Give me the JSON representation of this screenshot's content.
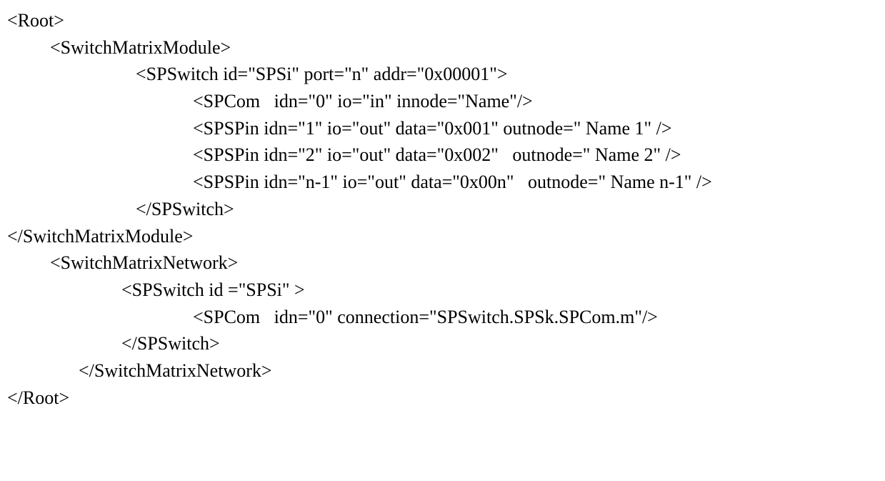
{
  "lines": {
    "l0": "<Root>",
    "l1": "<SwitchMatrixModule>",
    "l2": "<SPSwitch id=\"SPSi\" port=\"n\" addr=\"0x00001\">",
    "l3": "<SPCom   idn=\"0\" io=\"in\" innode=\"Name\"/>",
    "l4": "<SPSPin idn=\"1\" io=\"out\" data=\"0x001\" outnode=\" Name 1\" />",
    "l5": "<SPSPin idn=\"2\" io=\"out\" data=\"0x002\"   outnode=\" Name 2\" />",
    "l6": "<SPSPin idn=\"n-1\" io=\"out\" data=\"0x00n\"   outnode=\" Name n-1\" />",
    "l7": "</SPSwitch>",
    "l8": "</SwitchMatrixModule>",
    "l9": "<SwitchMatrixNetwork>",
    "l10": "<SPSwitch id =\"SPSi\" >",
    "l11": "<SPCom   idn=\"0\" connection=\"SPSwitch.SPSk.SPCom.m\"/>",
    "l12": "</SPSwitch>",
    "l13": "</SwitchMatrixNetwork>",
    "l14": "</Root>"
  }
}
